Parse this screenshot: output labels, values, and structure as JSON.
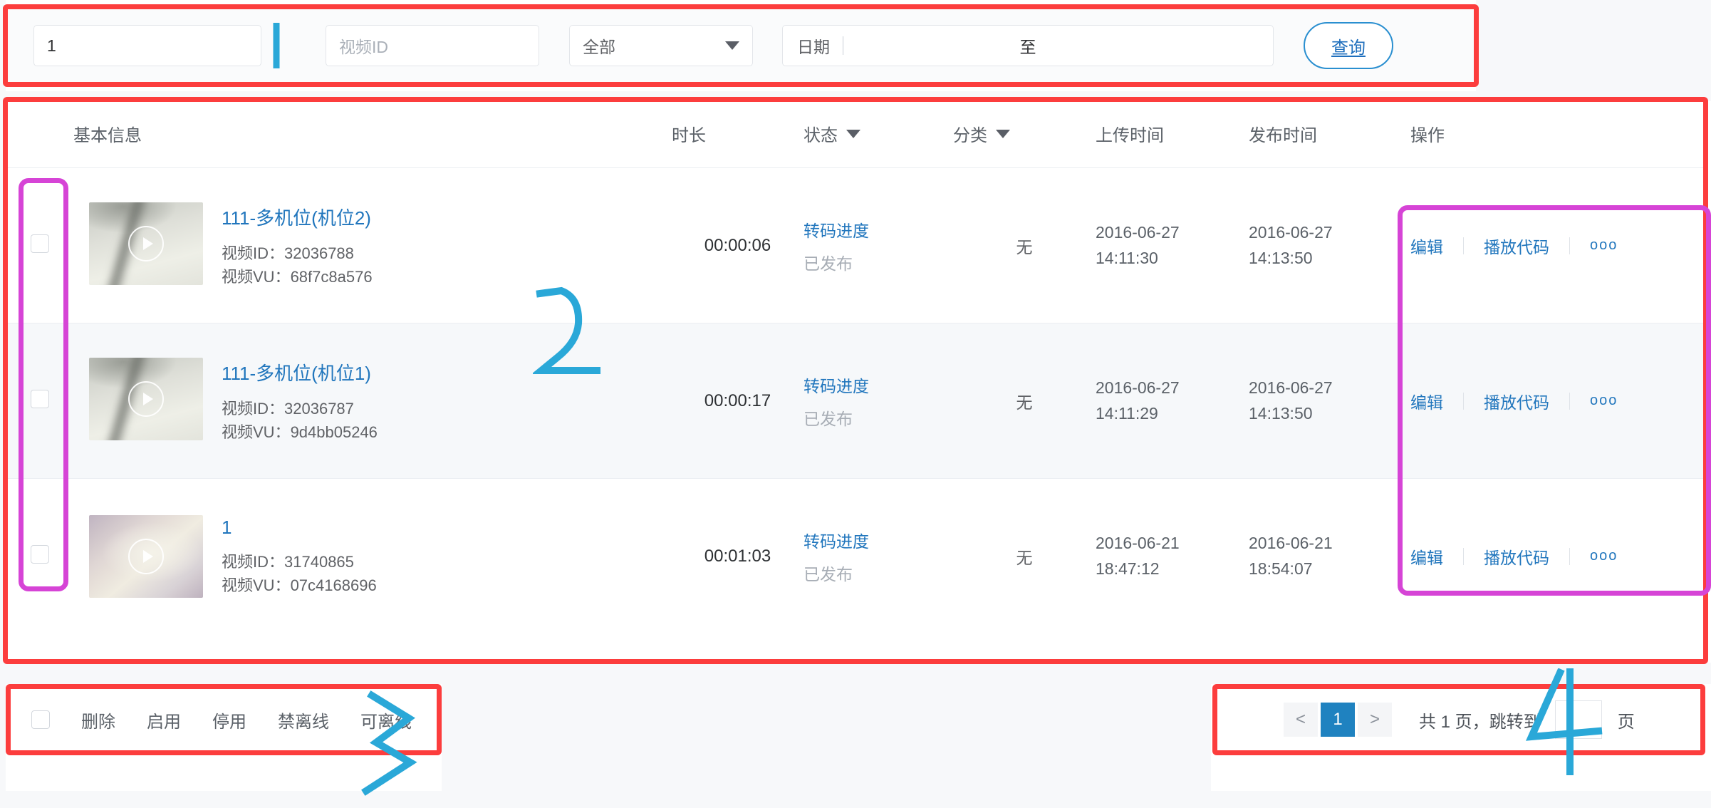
{
  "search": {
    "keyword_value": "1",
    "keyword_placeholder": "",
    "video_id_placeholder": "视频ID",
    "category_selected": "全部",
    "date_label": "日期",
    "date_to": "至",
    "query_button": "查询"
  },
  "table": {
    "headers": {
      "basic": "基本信息",
      "duration": "时长",
      "status": "状态",
      "category": "分类",
      "upload_time": "上传时间",
      "publish_time": "发布时间",
      "operation": "操作"
    },
    "meta_labels": {
      "video_id": "视频ID：",
      "video_vu": "视频VU："
    },
    "op_labels": {
      "edit": "编辑",
      "play_code": "播放代码",
      "more": "ooo"
    },
    "rows": [
      {
        "title": "111-多机位(机位2)",
        "video_id": "32036788",
        "video_vu": "68f7c8a576",
        "duration": "00:00:06",
        "status_link": "转码进度",
        "status_text": "已发布",
        "category": "无",
        "upload_date": "2016-06-27",
        "upload_time": "14:11:30",
        "publish_date": "2016-06-27",
        "publish_time": "14:13:50"
      },
      {
        "title": "111-多机位(机位1)",
        "video_id": "32036787",
        "video_vu": "9d4bb05246",
        "duration": "00:00:17",
        "status_link": "转码进度",
        "status_text": "已发布",
        "category": "无",
        "upload_date": "2016-06-27",
        "upload_time": "14:11:29",
        "publish_date": "2016-06-27",
        "publish_time": "14:13:50"
      },
      {
        "title": "1",
        "video_id": "31740865",
        "video_vu": "07c4168696",
        "duration": "00:01:03",
        "status_link": "转码进度",
        "status_text": "已发布",
        "category": "无",
        "upload_date": "2016-06-21",
        "upload_time": "18:47:12",
        "publish_date": "2016-06-21",
        "publish_time": "18:54:07"
      }
    ]
  },
  "bulk_actions": {
    "items": [
      {
        "label": "删除"
      },
      {
        "label": "启用"
      },
      {
        "label": "停用"
      },
      {
        "label": "禁离线"
      },
      {
        "label": "可离线"
      }
    ]
  },
  "pagination": {
    "prev": "<",
    "current": "1",
    "next": ">",
    "summary": "共 1 页，跳转到",
    "jump_value": "",
    "unit": "页"
  },
  "annotations": {
    "colors": {
      "red": "#fc3d3d",
      "magenta": "#d644d6",
      "blue": "#2aa8d8"
    },
    "marks": [
      {
        "id": "1",
        "label": "1"
      },
      {
        "id": "2",
        "label": "2"
      },
      {
        "id": "3",
        "label": "3"
      },
      {
        "id": "4",
        "label": "4"
      }
    ]
  }
}
